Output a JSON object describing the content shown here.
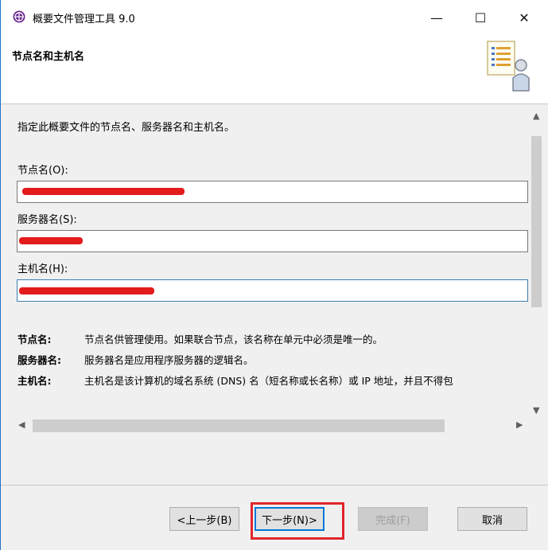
{
  "window": {
    "title": "概要文件管理工具 9.0",
    "controls": {
      "minimize": "—",
      "maximize": "☐",
      "close": "✕"
    }
  },
  "header": {
    "title": "节点名和主机名",
    "icon": "profile-user-icon"
  },
  "content": {
    "description": "指定此概要文件的节点名、服务器名和主机名。",
    "fields": [
      {
        "label": "节点名(O):",
        "value": ""
      },
      {
        "label": "服务器名(S):",
        "value": ""
      },
      {
        "label": "主机名(H):",
        "value": ""
      }
    ],
    "help": [
      {
        "key": "节点名:",
        "text": "节点名供管理使用。如果联合节点，该名称在单元中必须是唯一的。"
      },
      {
        "key": "服务器名:",
        "text": "服务器名是应用程序服务器的逻辑名。"
      },
      {
        "key": "主机名:",
        "text": "主机名是该计算机的域名系统 (DNS) 名（短名称或长名称）或 IP 地址，并且不得包"
      }
    ]
  },
  "buttons": {
    "back": "<上一步(B)",
    "next": "下一步(N)>",
    "finish": "完成(F)",
    "cancel": "取消"
  },
  "colors": {
    "accent": "#0078d7",
    "highlight": "#e0262b",
    "redaction": "#e21b1b"
  }
}
